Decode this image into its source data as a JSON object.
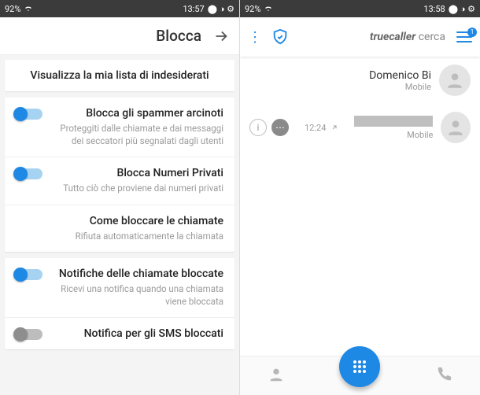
{
  "statusbar_left": {
    "signal": "92%",
    "time": "13:57"
  },
  "statusbar_right": {
    "signal": "92%",
    "time": "13:58"
  },
  "settings": {
    "title": "Blocca",
    "card1": {
      "title": "Visualizza la mia lista di indesiderati"
    },
    "card2": {
      "r1": {
        "title": "Blocca gli spammer arcinoti",
        "sub": "Proteggiti dalle chiamate e dai messaggi dei seccatori più segnalati dagli utenti"
      },
      "r2": {
        "title": "Blocca Numeri Privati",
        "sub": "Tutto ciò che proviene dai numeri privati"
      },
      "r3": {
        "title": "Come bloccare le chiamate",
        "sub": "Rifiuta automaticamente la chiamata"
      }
    },
    "card3": {
      "r1": {
        "title": "Notifiche delle chiamate bloccate",
        "sub": "Ricevi una notifica quando una chiamata viene bloccata"
      },
      "r2": {
        "title": "Notifica per gli SMS bloccati"
      }
    }
  },
  "log": {
    "brand_bold": "truecaller",
    "brand_rest": "cerca",
    "badge": "1",
    "items": [
      {
        "name": "Domenico Bi",
        "sub": "Mobile",
        "redacted": false
      },
      {
        "name": "",
        "sub": "Mobile",
        "redacted": true,
        "time": "12:24"
      }
    ]
  }
}
